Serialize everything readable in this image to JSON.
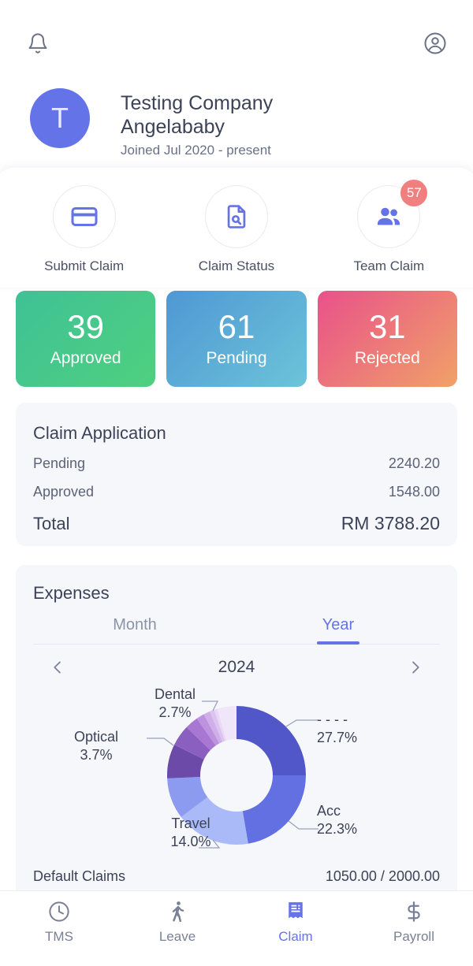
{
  "topbar": {
    "notification_icon": "bell-icon",
    "account_icon": "account-circle-icon"
  },
  "profile": {
    "avatar_initial": "T",
    "company": "Testing Company Angelababy",
    "joined": "Joined Jul 2020 - present"
  },
  "quick_actions": [
    {
      "label": "Submit Claim",
      "icon": "credit-card-icon",
      "badge": null
    },
    {
      "label": "Claim Status",
      "icon": "document-search-icon",
      "badge": null
    },
    {
      "label": "Team Claim",
      "icon": "people-icon",
      "badge": "57"
    }
  ],
  "stats": [
    {
      "value": "39",
      "label": "Approved",
      "color": "#45c78b"
    },
    {
      "value": "61",
      "label": "Pending",
      "color": "#5aaed6"
    },
    {
      "value": "31",
      "label": "Rejected",
      "color": "#ee6f82"
    }
  ],
  "claim_application": {
    "title": "Claim Application",
    "rows": [
      {
        "label": "Pending",
        "value": "2240.20"
      },
      {
        "label": "Approved",
        "value": "1548.00"
      }
    ],
    "total_label": "Total",
    "total_value": "RM 3788.20"
  },
  "expenses": {
    "title": "Expenses",
    "tabs": [
      {
        "label": "Month",
        "active": false
      },
      {
        "label": "Year",
        "active": true
      }
    ],
    "prev_icon": "chevron-left-icon",
    "next_icon": "chevron-right-icon",
    "period": "2024",
    "default_claims": {
      "label": "Default Claims",
      "value": "1050.00 / 2000.00"
    }
  },
  "chart_data": {
    "type": "pie",
    "title": "Expenses",
    "donut": true,
    "labels": [
      "- - - -",
      "Acc",
      "Travel",
      "Optical",
      "Dental"
    ],
    "values": [
      27.7,
      22.3,
      14.0,
      3.7,
      2.7
    ],
    "display_values": [
      "27.7%",
      "22.3%",
      "14.0%",
      "3.7%",
      "2.7%"
    ],
    "slices": [
      {
        "label": "- - - -",
        "display_value": "27.7%",
        "value": 27.7,
        "color": "#5157c8"
      },
      {
        "label": "Acc",
        "display_value": "22.3%",
        "value": 22.3,
        "color": "#6370e2"
      },
      {
        "label": "Travel",
        "display_value": "14.0%",
        "value": 14.0,
        "color": "#8c9bf0"
      },
      {
        "label": "",
        "display_value": "",
        "value": 13.0,
        "color": "#aabaf8"
      },
      {
        "label": "Optical",
        "display_value": "3.7%",
        "value": 8.0,
        "color": "#6b4aa8"
      },
      {
        "label": "",
        "display_value": "",
        "value": 5.5,
        "color": "#8a5fc0"
      },
      {
        "label": "Dental",
        "display_value": "2.7%",
        "value": 3.6,
        "color": "#a877d2"
      },
      {
        "label": "",
        "display_value": "",
        "value": 2.2,
        "color": "#bd92de"
      },
      {
        "label": "",
        "display_value": "",
        "value": 1.8,
        "color": "#d0aeea"
      },
      {
        "label": "",
        "display_value": "",
        "value": 1.3,
        "color": "#ddc4f0"
      },
      {
        "label": "",
        "display_value": "",
        "value": 0.9,
        "color": "#e8d8f5"
      }
    ],
    "legend": "labels-with-leader-lines"
  },
  "bottom_nav": [
    {
      "label": "TMS",
      "icon": "clock-icon",
      "active": false
    },
    {
      "label": "Leave",
      "icon": "walking-icon",
      "active": false
    },
    {
      "label": "Claim",
      "icon": "receipt-icon",
      "active": true
    },
    {
      "label": "Payroll",
      "icon": "dollar-icon",
      "active": false
    }
  ]
}
